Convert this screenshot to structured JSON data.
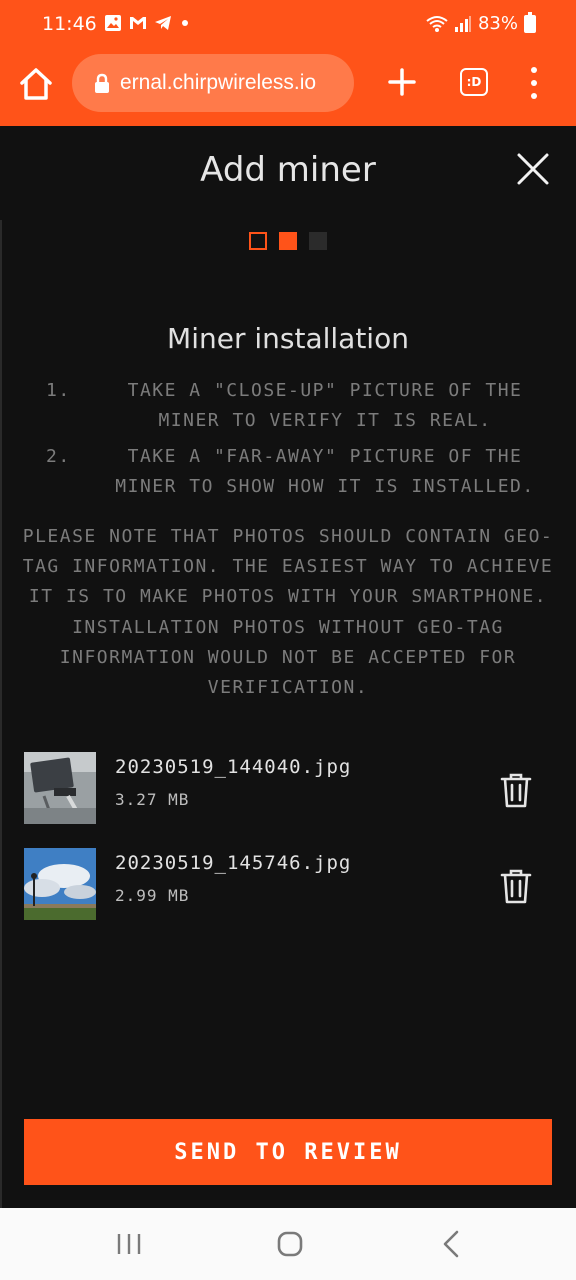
{
  "status_bar": {
    "time": "11:46",
    "battery": "83%",
    "left_icons": [
      "gallery-icon",
      "gmail-icon",
      "telegram-icon",
      "dot-icon"
    ],
    "right_icons": [
      "wifi-icon",
      "signal-icon",
      "battery-icon"
    ]
  },
  "browser": {
    "url": "ernal.chirpwireless.io",
    "tab_label": ":D"
  },
  "modal": {
    "title": "Add miner",
    "steps": {
      "total": 3,
      "current": 2
    },
    "subtitle": "Miner installation",
    "instructions": [
      {
        "num": "1.",
        "text": "TAKE A \"CLOSE-UP\" PICTURE OF THE MINER TO VERIFY IT IS REAL."
      },
      {
        "num": "2.",
        "text": "TAKE A \"FAR-AWAY\" PICTURE OF THE MINER TO SHOW HOW IT IS INSTALLED."
      }
    ],
    "note": "PLEASE NOTE THAT PHOTOS SHOULD CONTAIN GEO-TAG INFORMATION. THE EASIEST WAY TO ACHIEVE IT IS TO MAKE PHOTOS WITH YOUR SMARTPHONE. INSTALLATION PHOTOS WITHOUT GEO-TAG INFORMATION WOULD NOT BE ACCEPTED FOR VERIFICATION.",
    "files": [
      {
        "name": "20230519_144040.jpg",
        "size": "3.27 MB"
      },
      {
        "name": "20230519_145746.jpg",
        "size": "2.99 MB"
      }
    ],
    "submit_label": "SEND TO REVIEW"
  },
  "colors": {
    "accent": "#ff5319",
    "background": "#111111",
    "muted_text": "#7c7c7c"
  }
}
